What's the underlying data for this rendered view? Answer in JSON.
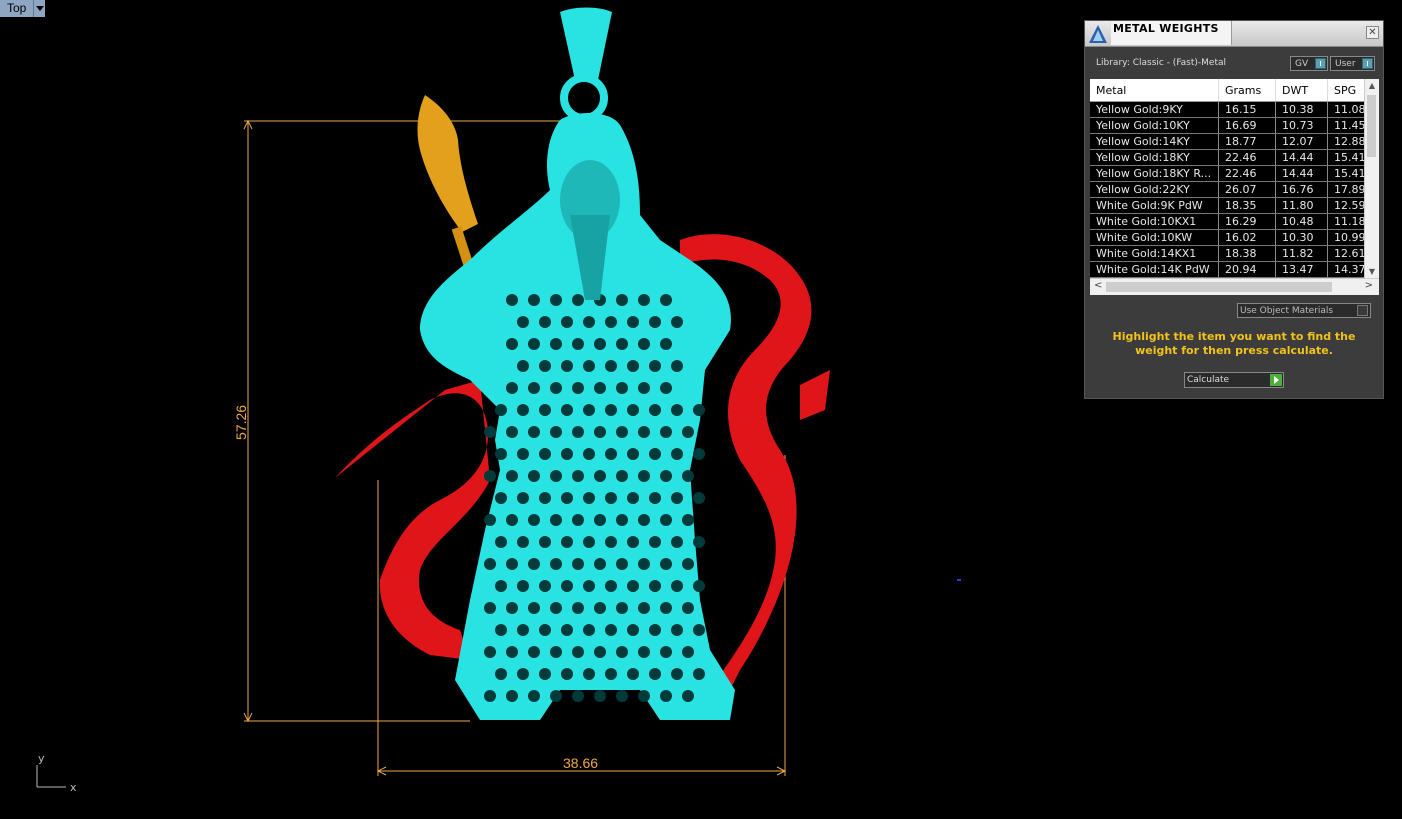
{
  "viewport": {
    "name": "Top"
  },
  "dimensions": {
    "height": "57.26",
    "width": "38.66"
  },
  "axes": {
    "y": "y",
    "x": "x"
  },
  "colors": {
    "body": "#29e3e3",
    "dragon": "#e0151a",
    "blade": "#e3a01c",
    "dimension": "#f0a64a",
    "instruction": "#f2c21d"
  },
  "panel": {
    "title": "METAL WEIGHTS",
    "close": "✕",
    "library": "Library: Classic - (Fast)-Metal",
    "toggle_gv": "GV",
    "toggle_user": "User",
    "table": {
      "headers": [
        "Metal",
        "Grams",
        "DWT",
        "SPG"
      ],
      "rows": [
        [
          "Yellow Gold:9KY",
          "16.15",
          "10.38",
          "11.08"
        ],
        [
          "Yellow Gold:10KY",
          "16.69",
          "10.73",
          "11.45"
        ],
        [
          "Yellow Gold:14KY",
          "18.77",
          "12.07",
          "12.88"
        ],
        [
          "Yellow Gold:18KY",
          "22.46",
          "14.44",
          "15.41"
        ],
        [
          "Yellow Gold:18KY R...",
          "22.46",
          "14.44",
          "15.41"
        ],
        [
          "Yellow Gold:22KY",
          "26.07",
          "16.76",
          "17.89"
        ],
        [
          "White Gold:9K PdW",
          "18.35",
          "11.80",
          "12.59"
        ],
        [
          "White Gold:10KX1",
          "16.29",
          "10.48",
          "11.18"
        ],
        [
          "White Gold:10KW",
          "16.02",
          "10.30",
          "10.99"
        ],
        [
          "White Gold:14KX1",
          "18.38",
          "11.82",
          "12.61"
        ],
        [
          "White Gold:14K PdW",
          "20.94",
          "13.47",
          "14.37"
        ]
      ]
    },
    "use_object_materials": "Use Object Materials",
    "instruction": "Highlight the item you want to find the weight for then press calculate.",
    "calculate": "Calculate"
  }
}
